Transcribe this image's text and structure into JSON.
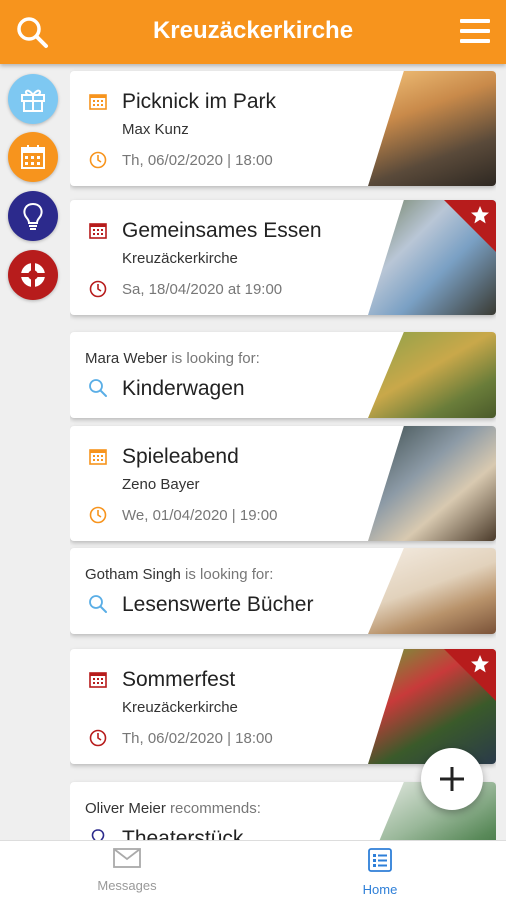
{
  "header": {
    "title": "Kreuzäckerkirche",
    "search_icon": "search-icon",
    "menu_icon": "menu-icon"
  },
  "rail": [
    {
      "name": "gift-category",
      "icon": "gift-icon",
      "color": "#7ec8f2"
    },
    {
      "name": "calendar-category",
      "icon": "calendar-icon",
      "color": "#f7941d"
    },
    {
      "name": "idea-category",
      "icon": "lightbulb-icon",
      "color": "#2c2a8c"
    },
    {
      "name": "help-category",
      "icon": "lifebuoy-icon",
      "color": "#b71c1c"
    }
  ],
  "feed": {
    "cards": [
      {
        "type": "event",
        "title": "Picknick im Park",
        "organizer": "Max Kunz",
        "date": "Th, 06/02/2020 | 18:00",
        "accent": "#f7941d",
        "featured": false
      },
      {
        "type": "event",
        "title": "Gemeinsames Essen",
        "organizer": "Kreuzäckerkirche",
        "date": "Sa, 18/04/2020 at 19:00",
        "accent": "#b71c1c",
        "featured": true
      },
      {
        "type": "looking",
        "person": "Mara Weber",
        "phrase": " is looking for:",
        "item": "Kinderwagen"
      },
      {
        "type": "event",
        "title": "Spieleabend",
        "organizer": "Zeno Bayer",
        "date": "We, 01/04/2020 | 19:00",
        "accent": "#f7941d",
        "featured": false
      },
      {
        "type": "looking",
        "person": "Gotham Singh",
        "phrase": " is looking for:",
        "item": "Lesenswerte Bücher"
      },
      {
        "type": "event",
        "title": "Sommerfest",
        "organizer": "Kreuzäckerkirche",
        "date": "Th, 06/02/2020 | 18:00",
        "accent": "#b71c1c",
        "featured": true
      },
      {
        "type": "recommend",
        "person": "Oliver Meier",
        "phrase": " recommends:",
        "item": "Theaterstück"
      }
    ]
  },
  "fab": {
    "icon": "plus-icon"
  },
  "bottom_nav": {
    "messages": {
      "label": "Messages",
      "icon": "mail-icon"
    },
    "home": {
      "label": "Home",
      "icon": "list-icon",
      "active_color": "#2e7fd8"
    }
  }
}
